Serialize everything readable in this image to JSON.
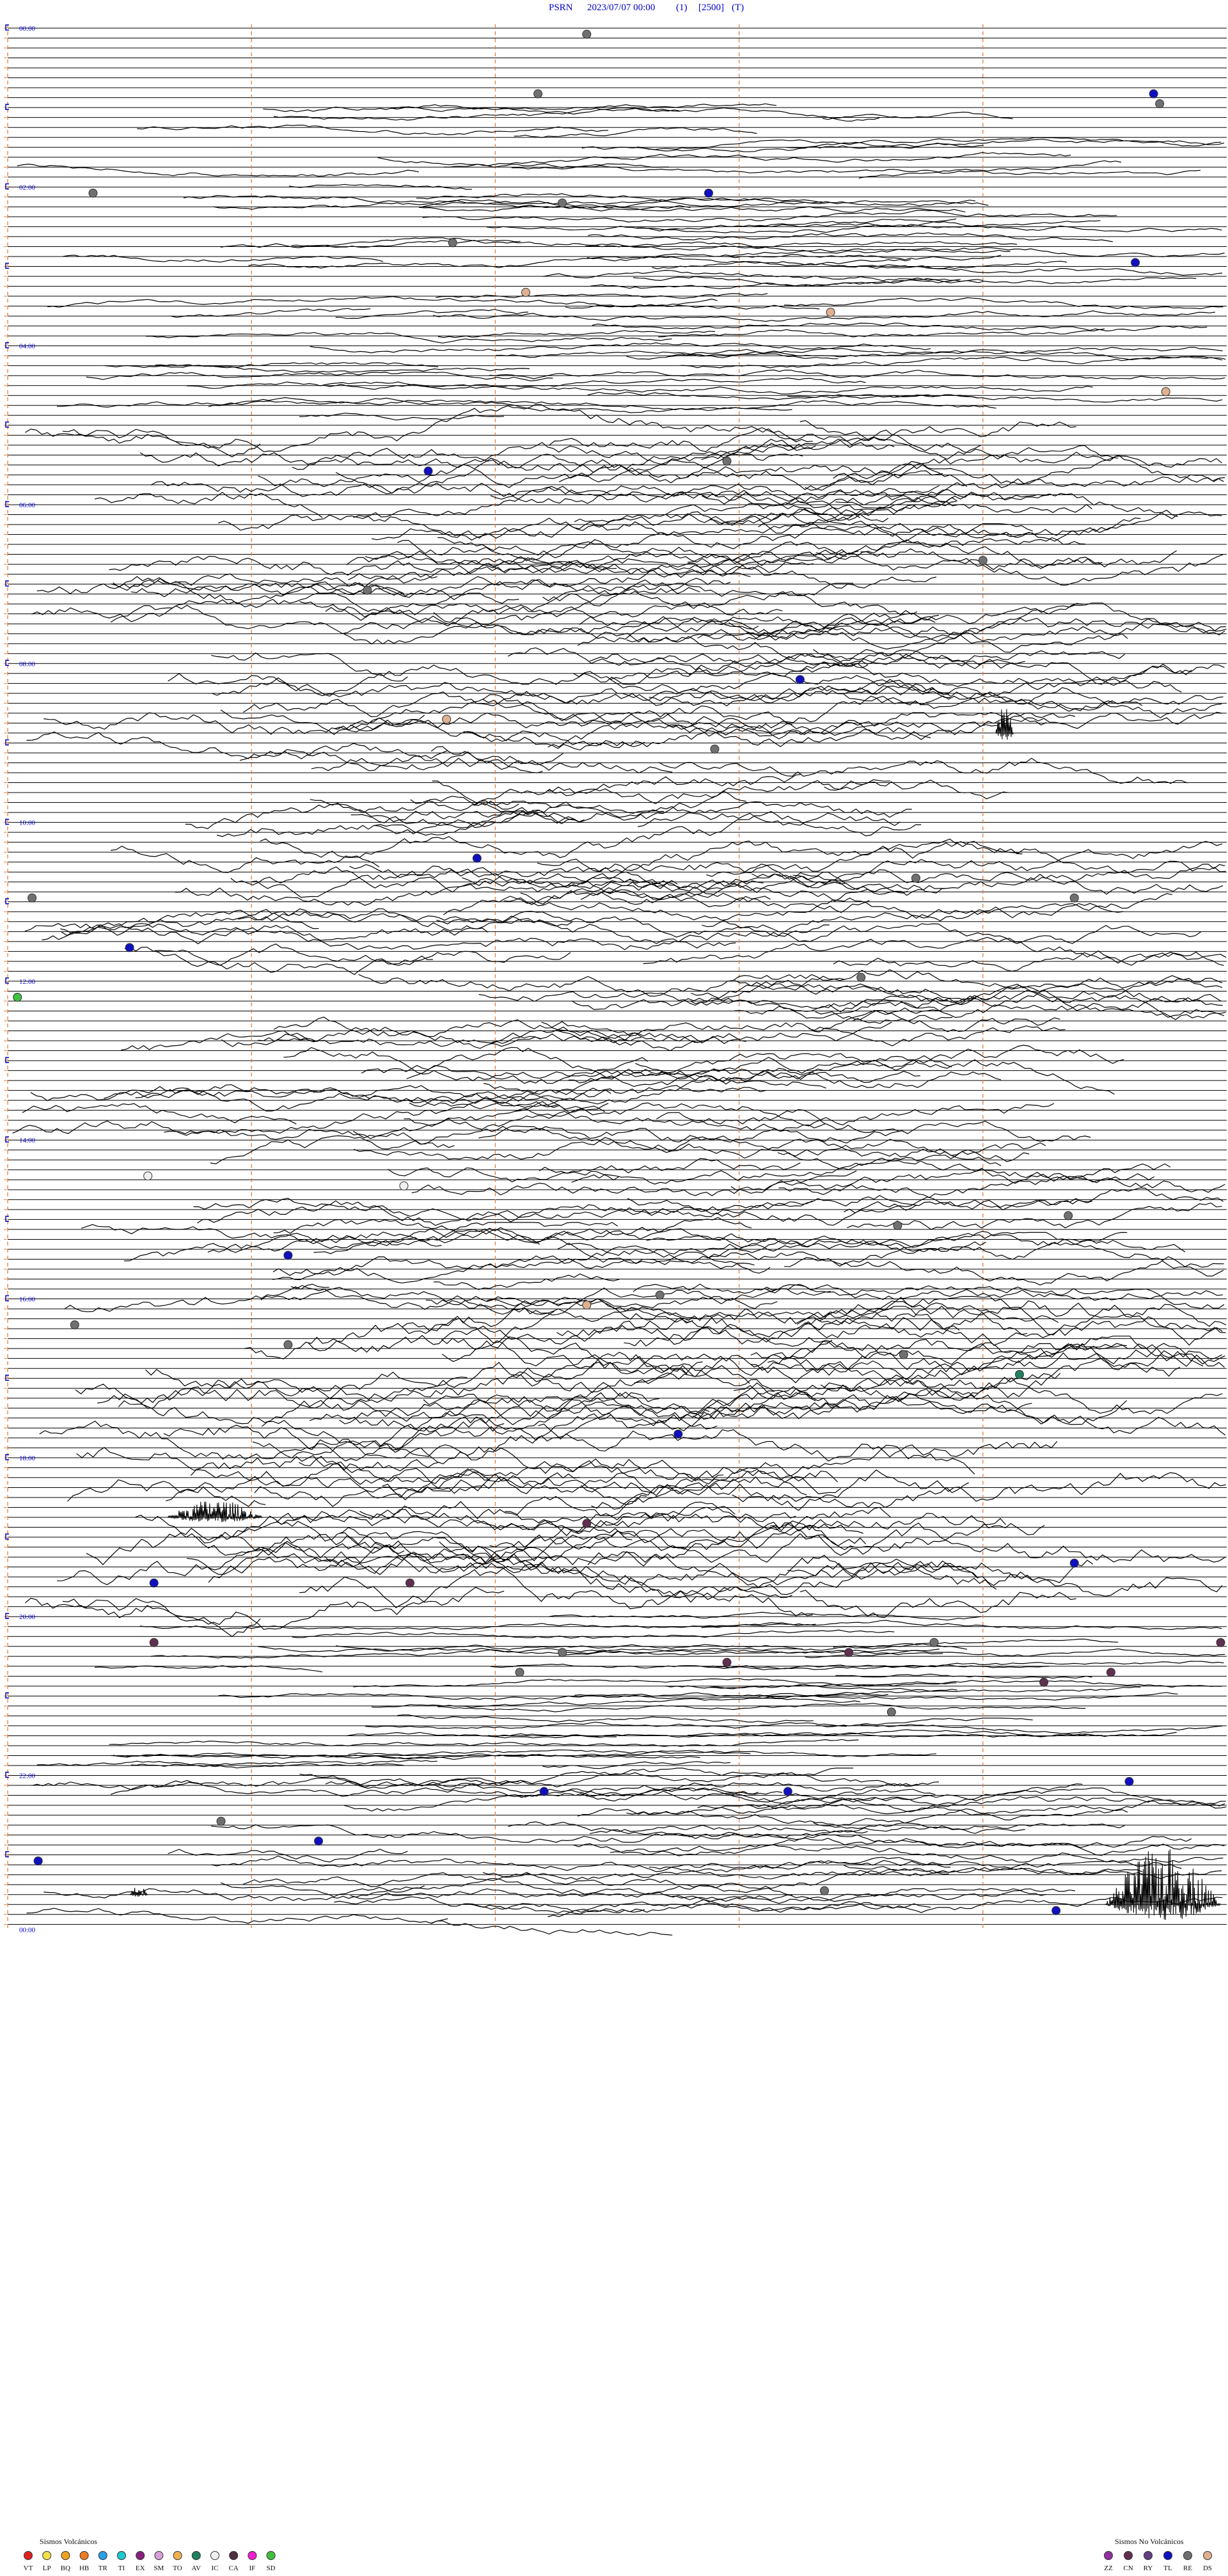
{
  "header": {
    "station": "PSRN",
    "datetime": "2023/07/07 00:00",
    "channel": "(1)",
    "gain": "[2500]",
    "flag": "(T)"
  },
  "chart_data": {
    "type": "helicorder",
    "trace_count": 192,
    "traces_per_hour": 8,
    "hour_labels": [
      "00:00",
      "02:00",
      "04:00",
      "06:00",
      "08:00",
      "10:00",
      "12:00",
      "14:00",
      "16:00",
      "18:00",
      "20:00",
      "22:00",
      "00:00"
    ],
    "vertical_markers_fraction": [
      0.0,
      0.2,
      0.4,
      0.6,
      0.8
    ],
    "marker_color": "#e08040",
    "activity": [
      {
        "from": 8,
        "to": 40,
        "amp": 0.5
      },
      {
        "from": 40,
        "to": 88,
        "amp": 1.6
      },
      {
        "from": 88,
        "to": 140,
        "amp": 1.4
      },
      {
        "from": 96,
        "to": 104,
        "amp": 0.6
      },
      {
        "from": 140,
        "to": 176,
        "amp": 0.4
      },
      {
        "from": 130,
        "to": 160,
        "amp": 2.2
      },
      {
        "from": 176,
        "to": 192,
        "amp": 0.9
      }
    ],
    "event_marks": [
      {
        "row": 1,
        "pos": 0.475,
        "type": "RE"
      },
      {
        "row": 7,
        "pos": 0.435,
        "type": "RE"
      },
      {
        "row": 7,
        "pos": 0.94,
        "type": "TL"
      },
      {
        "row": 8,
        "pos": 0.945,
        "type": "RE"
      },
      {
        "row": 17,
        "pos": 0.07,
        "type": "RE"
      },
      {
        "row": 17,
        "pos": 0.575,
        "type": "TL"
      },
      {
        "row": 18,
        "pos": 0.455,
        "type": "RE"
      },
      {
        "row": 22,
        "pos": 0.365,
        "type": "RE"
      },
      {
        "row": 24,
        "pos": 0.925,
        "type": "TL"
      },
      {
        "row": 27,
        "pos": 0.425,
        "type": "DS"
      },
      {
        "row": 29,
        "pos": 0.675,
        "type": "DS"
      },
      {
        "row": 37,
        "pos": 0.95,
        "type": "DS"
      },
      {
        "row": 44,
        "pos": 0.59,
        "type": "RE"
      },
      {
        "row": 45,
        "pos": 0.345,
        "type": "TL"
      },
      {
        "row": 54,
        "pos": 0.8,
        "type": "RE"
      },
      {
        "row": 57,
        "pos": 0.295,
        "type": "RE"
      },
      {
        "row": 66,
        "pos": 0.65,
        "type": "TL"
      },
      {
        "row": 70,
        "pos": 0.36,
        "type": "DS"
      },
      {
        "row": 73,
        "pos": 0.58,
        "type": "RE"
      },
      {
        "row": 84,
        "pos": 0.385,
        "type": "TL"
      },
      {
        "row": 86,
        "pos": 0.745,
        "type": "RE"
      },
      {
        "row": 88,
        "pos": 0.875,
        "type": "RE"
      },
      {
        "row": 88,
        "pos": 0.02,
        "type": "RE"
      },
      {
        "row": 93,
        "pos": 0.1,
        "type": "TL"
      },
      {
        "row": 96,
        "pos": 0.7,
        "type": "RE"
      },
      {
        "row": 98,
        "pos": 0.008,
        "type": "SD"
      },
      {
        "row": 116,
        "pos": 0.115,
        "type": "IC"
      },
      {
        "row": 117,
        "pos": 0.325,
        "type": "IC"
      },
      {
        "row": 121,
        "pos": 0.73,
        "type": "RE"
      },
      {
        "row": 120,
        "pos": 0.87,
        "type": "RE"
      },
      {
        "row": 124,
        "pos": 0.23,
        "type": "TL"
      },
      {
        "row": 128,
        "pos": 0.535,
        "type": "RE"
      },
      {
        "row": 129,
        "pos": 0.475,
        "type": "DS"
      },
      {
        "row": 131,
        "pos": 0.055,
        "type": "RE"
      },
      {
        "row": 133,
        "pos": 0.23,
        "type": "RE"
      },
      {
        "row": 134,
        "pos": 0.735,
        "type": "RE"
      },
      {
        "row": 136,
        "pos": 0.83,
        "type": "AV"
      },
      {
        "row": 142,
        "pos": 0.55,
        "type": "TL"
      },
      {
        "row": 151,
        "pos": 0.475,
        "type": "CN"
      },
      {
        "row": 155,
        "pos": 0.875,
        "type": "TL"
      },
      {
        "row": 157,
        "pos": 0.12,
        "type": "TL"
      },
      {
        "row": 157,
        "pos": 0.33,
        "type": "CN"
      },
      {
        "row": 163,
        "pos": 0.12,
        "type": "CN"
      },
      {
        "row": 163,
        "pos": 0.76,
        "type": "RE"
      },
      {
        "row": 163,
        "pos": 0.995,
        "type": "CN"
      },
      {
        "row": 164,
        "pos": 0.455,
        "type": "RE"
      },
      {
        "row": 164,
        "pos": 0.69,
        "type": "CN"
      },
      {
        "row": 165,
        "pos": 0.59,
        "type": "CN"
      },
      {
        "row": 166,
        "pos": 0.42,
        "type": "RE"
      },
      {
        "row": 166,
        "pos": 0.905,
        "type": "CN"
      },
      {
        "row": 167,
        "pos": 0.85,
        "type": "CN"
      },
      {
        "row": 170,
        "pos": 0.725,
        "type": "RE"
      },
      {
        "row": 177,
        "pos": 0.92,
        "type": "TL"
      },
      {
        "row": 178,
        "pos": 0.44,
        "type": "TL"
      },
      {
        "row": 178,
        "pos": 0.64,
        "type": "TL"
      },
      {
        "row": 181,
        "pos": 0.175,
        "type": "RE"
      },
      {
        "row": 183,
        "pos": 0.255,
        "type": "TL"
      },
      {
        "row": 185,
        "pos": 0.025,
        "type": "TL"
      },
      {
        "row": 188,
        "pos": 0.67,
        "type": "RE"
      },
      {
        "row": 190,
        "pos": 0.86,
        "type": "TL"
      }
    ],
    "bursts": [
      {
        "row": 71,
        "pos": 0.81,
        "width": 0.015,
        "height": 48
      },
      {
        "row": 150,
        "pos": 0.13,
        "width": 0.08,
        "height": 28
      },
      {
        "row": 188,
        "pos": 0.1,
        "width": 0.015,
        "height": 14
      },
      {
        "row": 189,
        "pos": 0.9,
        "width": 0.095,
        "height": 90
      }
    ]
  },
  "legend_volcanic": {
    "title": "Sismos Volcánicos",
    "items": [
      {
        "code": "VT",
        "color": "#e02020"
      },
      {
        "code": "LP",
        "color": "#f2e04a"
      },
      {
        "code": "BQ",
        "color": "#f2a020"
      },
      {
        "code": "HB",
        "color": "#f07a20"
      },
      {
        "code": "TR",
        "color": "#2aa0e8"
      },
      {
        "code": "TI",
        "color": "#20c8d0"
      },
      {
        "code": "EX",
        "color": "#882080"
      },
      {
        "code": "SM",
        "color": "#d8a0d8"
      },
      {
        "code": "TO",
        "color": "#f0b050"
      },
      {
        "code": "AV",
        "color": "#208060"
      },
      {
        "code": "IC",
        "color": "#f0f0f0"
      },
      {
        "code": "CA",
        "color": "#503040"
      },
      {
        "code": "IF",
        "color": "#f020d0"
      },
      {
        "code": "SD",
        "color": "#40c040"
      }
    ]
  },
  "legend_nonvolcanic": {
    "title": "Sismos No Volcánicos",
    "items": [
      {
        "code": "ZZ",
        "color": "#9030a0"
      },
      {
        "code": "CN",
        "color": "#603050"
      },
      {
        "code": "RY",
        "color": "#604080"
      },
      {
        "code": "TL",
        "color": "#1010c0"
      },
      {
        "code": "RE",
        "color": "#707070"
      },
      {
        "code": "DS",
        "color": "#e0b090"
      }
    ]
  }
}
